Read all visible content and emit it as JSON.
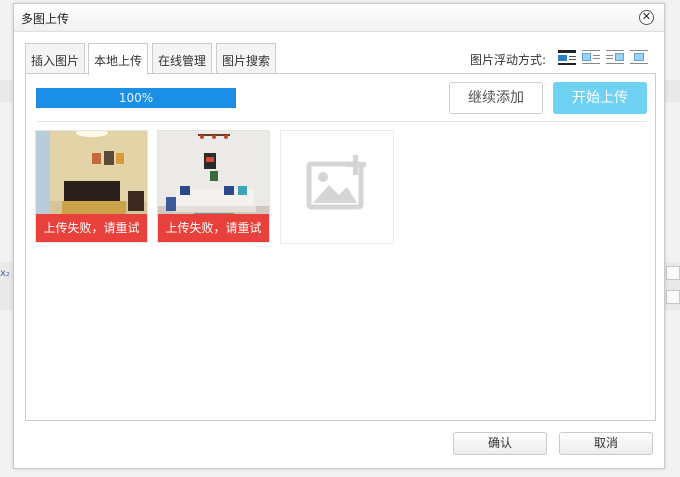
{
  "dialog": {
    "title": "多图上传",
    "close_glyph": "✕"
  },
  "tabs": [
    {
      "label": "插入图片",
      "active": false
    },
    {
      "label": "本地上传",
      "active": true
    },
    {
      "label": "在线管理",
      "active": false
    },
    {
      "label": "图片搜索",
      "active": false
    }
  ],
  "float_mode": {
    "label": "图片浮动方式:",
    "options": [
      "none-align-icon",
      "left-align-icon",
      "right-align-icon",
      "center-align-icon"
    ]
  },
  "upload": {
    "progress_text": "100%",
    "progress_percent": 100,
    "add_more_label": "继续添加",
    "start_label": "开始上传",
    "items": [
      {
        "error_text": "上传失败，请重试",
        "subject": "bedroom"
      },
      {
        "error_text": "上传失败，请重试",
        "subject": "living-room"
      }
    ],
    "add_slot_icon": "add-image-icon"
  },
  "footer": {
    "confirm_label": "确认",
    "cancel_label": "取消"
  },
  "colors": {
    "progress": "#1b8ee6",
    "start_button": "#6fd2f3",
    "error_banner": "#e8403a",
    "active_align": "#2a7fc6"
  }
}
